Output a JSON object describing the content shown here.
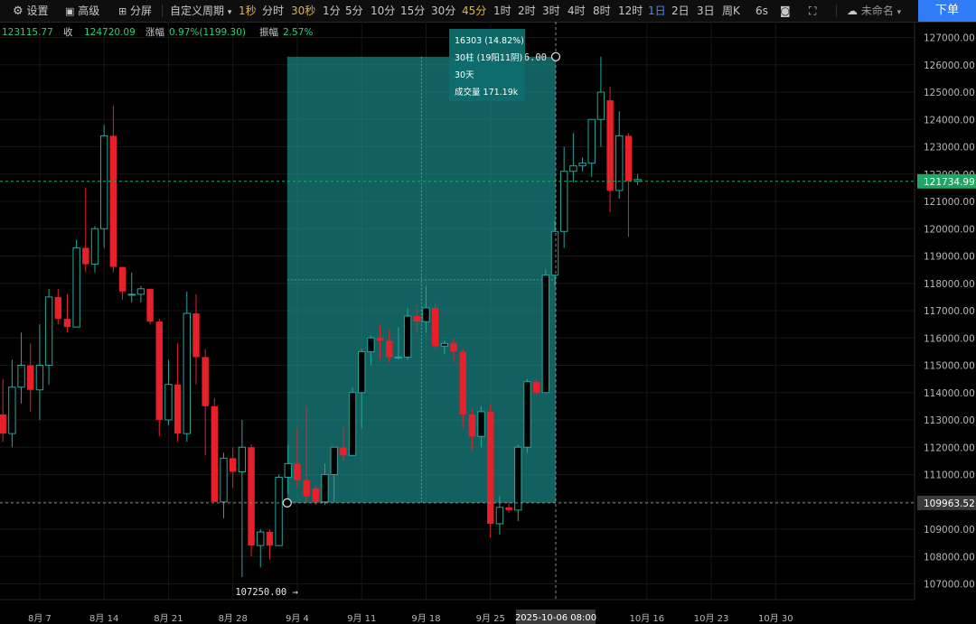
{
  "toolbar": {
    "settings": "设置",
    "advanced": "高级",
    "split": "分屏",
    "custom_period": "自定义周期",
    "periods": [
      "1秒",
      "分时",
      "30秒",
      "1分",
      "5分",
      "10分",
      "15分",
      "30分",
      "45分",
      "1时",
      "2时",
      "3时",
      "4时",
      "8时",
      "12时",
      "1日",
      "2日",
      "3日",
      "周K",
      "6s"
    ],
    "highlight_periods": [
      "1秒",
      "30秒",
      "45分"
    ],
    "active_period": "1日",
    "unnamed": "未命名",
    "order_button": "下单"
  },
  "info_bar": {
    "open_value": "123115.77",
    "close_label": "收",
    "close_value": "124720.09",
    "change_label": "涨幅",
    "change_value": "0.97%(1199.30)",
    "amplitude_label": "振幅",
    "amplitude_value": "2.57%"
  },
  "measure": {
    "line1": "16303 (14.82%)",
    "line2": "30柱 (19阳11阴)",
    "line3": "30天",
    "line4": "成交量 171.19k",
    "start_price": 109963.52,
    "end_price": 126296.0,
    "start_index": 31,
    "end_index": 60
  },
  "annotations": {
    "high_label": "126296.00",
    "low_label": "107250.00 →",
    "low_index": 26,
    "low_price": 107250.0,
    "current_price_label": "121734.99",
    "current_price": 121734.99,
    "crosshair_price_label": "109963.52",
    "crosshair_date_label": "2025-10-06 08:00",
    "crosshair_index": 60
  },
  "colors": {
    "up": "#26a69a",
    "down": "#e8202a",
    "price_badge": "#1ea863",
    "accent": "#e0b440",
    "active": "#4a8cf7",
    "order_button": "#2f7cf6",
    "measure_fill": "#1f9b9b"
  },
  "chart_data": {
    "type": "candlestick",
    "ylim": [
      106400,
      127500
    ],
    "yticks": [
      107000,
      108000,
      109000,
      110000,
      111000,
      112000,
      113000,
      114000,
      115000,
      116000,
      117000,
      118000,
      119000,
      120000,
      121000,
      122000,
      123000,
      124000,
      125000,
      126000,
      127000
    ],
    "xticks": [
      {
        "label": "8月 7",
        "index": 4
      },
      {
        "label": "8月 14",
        "index": 11
      },
      {
        "label": "8月 21",
        "index": 18
      },
      {
        "label": "8月 28",
        "index": 25
      },
      {
        "label": "9月 4",
        "index": 32
      },
      {
        "label": "9月 11",
        "index": 39
      },
      {
        "label": "9月 18",
        "index": 46
      },
      {
        "label": "9月 25",
        "index": 53
      },
      {
        "label": "10月 16",
        "index": 70
      },
      {
        "label": "10月 23",
        "index": 77
      },
      {
        "label": "10月 30",
        "index": 84
      }
    ],
    "candles": [
      {
        "o": 113200,
        "h": 114500,
        "l": 112200,
        "c": 112500
      },
      {
        "o": 112500,
        "h": 115200,
        "l": 112000,
        "c": 114200
      },
      {
        "o": 114200,
        "h": 116200,
        "l": 113600,
        "c": 115000
      },
      {
        "o": 115000,
        "h": 115800,
        "l": 113300,
        "c": 114100
      },
      {
        "o": 114100,
        "h": 116500,
        "l": 113000,
        "c": 115000
      },
      {
        "o": 115000,
        "h": 117800,
        "l": 114300,
        "c": 117500
      },
      {
        "o": 117500,
        "h": 117800,
        "l": 116500,
        "c": 116700
      },
      {
        "o": 116700,
        "h": 117600,
        "l": 116200,
        "c": 116400
      },
      {
        "o": 116400,
        "h": 119600,
        "l": 116400,
        "c": 119300
      },
      {
        "o": 119300,
        "h": 121500,
        "l": 118400,
        "c": 118700
      },
      {
        "o": 118700,
        "h": 120100,
        "l": 118400,
        "c": 120000
      },
      {
        "o": 120000,
        "h": 123800,
        "l": 119300,
        "c": 123400
      },
      {
        "o": 123400,
        "h": 124500,
        "l": 118400,
        "c": 118600
      },
      {
        "o": 118600,
        "h": 118600,
        "l": 117400,
        "c": 117700
      },
      {
        "o": 117600,
        "h": 118400,
        "l": 117300,
        "c": 117600
      },
      {
        "o": 117600,
        "h": 117900,
        "l": 117300,
        "c": 117800
      },
      {
        "o": 117800,
        "h": 117800,
        "l": 116500,
        "c": 116600
      },
      {
        "o": 116600,
        "h": 116700,
        "l": 112400,
        "c": 113000
      },
      {
        "o": 113000,
        "h": 115200,
        "l": 112800,
        "c": 114300
      },
      {
        "o": 114300,
        "h": 115800,
        "l": 112200,
        "c": 112500
      },
      {
        "o": 112500,
        "h": 117700,
        "l": 112200,
        "c": 116900
      },
      {
        "o": 116900,
        "h": 117600,
        "l": 114300,
        "c": 115300
      },
      {
        "o": 115300,
        "h": 115600,
        "l": 111700,
        "c": 113500
      },
      {
        "o": 113500,
        "h": 113800,
        "l": 110600,
        "c": 110000
      },
      {
        "o": 110000,
        "h": 111800,
        "l": 109400,
        "c": 111600
      },
      {
        "o": 111600,
        "h": 112000,
        "l": 110500,
        "c": 111100
      },
      {
        "o": 111100,
        "h": 113000,
        "l": 107250,
        "c": 112000
      },
      {
        "o": 112000,
        "h": 112100,
        "l": 108000,
        "c": 108400
      },
      {
        "o": 108400,
        "h": 109000,
        "l": 107600,
        "c": 108900
      },
      {
        "o": 108900,
        "h": 109000,
        "l": 107900,
        "c": 108400
      },
      {
        "o": 108400,
        "h": 111000,
        "l": 108400,
        "c": 110900
      },
      {
        "o": 110900,
        "h": 112100,
        "l": 110300,
        "c": 111400
      },
      {
        "o": 111400,
        "h": 112700,
        "l": 110500,
        "c": 110800
      },
      {
        "o": 110800,
        "h": 113500,
        "l": 110000,
        "c": 110200
      },
      {
        "o": 110500,
        "h": 110600,
        "l": 109900,
        "c": 110000
      },
      {
        "o": 110000,
        "h": 111400,
        "l": 109900,
        "c": 111000
      },
      {
        "o": 111000,
        "h": 112000,
        "l": 110000,
        "c": 112000
      },
      {
        "o": 112000,
        "h": 112800,
        "l": 111500,
        "c": 111700
      },
      {
        "o": 111700,
        "h": 114200,
        "l": 111700,
        "c": 114000
      },
      {
        "o": 114000,
        "h": 115600,
        "l": 112700,
        "c": 115500
      },
      {
        "o": 115500,
        "h": 116100,
        "l": 115000,
        "c": 116000
      },
      {
        "o": 116000,
        "h": 116500,
        "l": 115200,
        "c": 115900
      },
      {
        "o": 115900,
        "h": 116300,
        "l": 115100,
        "c": 115300
      },
      {
        "o": 115300,
        "h": 116400,
        "l": 115200,
        "c": 115300
      },
      {
        "o": 115300,
        "h": 117100,
        "l": 115200,
        "c": 116800
      },
      {
        "o": 116800,
        "h": 117200,
        "l": 116200,
        "c": 116600
      },
      {
        "o": 116600,
        "h": 117900,
        "l": 116200,
        "c": 117100
      },
      {
        "o": 117100,
        "h": 117300,
        "l": 115600,
        "c": 115700
      },
      {
        "o": 115700,
        "h": 115900,
        "l": 115400,
        "c": 115800
      },
      {
        "o": 115800,
        "h": 116000,
        "l": 115100,
        "c": 115500
      },
      {
        "o": 115500,
        "h": 115600,
        "l": 112700,
        "c": 113200
      },
      {
        "o": 113200,
        "h": 113400,
        "l": 111900,
        "c": 112400
      },
      {
        "o": 112400,
        "h": 113500,
        "l": 112000,
        "c": 113300
      },
      {
        "o": 113300,
        "h": 113600,
        "l": 108700,
        "c": 109200
      },
      {
        "o": 109200,
        "h": 110200,
        "l": 108800,
        "c": 109800
      },
      {
        "o": 109800,
        "h": 110000,
        "l": 109600,
        "c": 109700
      },
      {
        "o": 109700,
        "h": 112100,
        "l": 109300,
        "c": 112000
      },
      {
        "o": 112000,
        "h": 114500,
        "l": 111800,
        "c": 114400
      },
      {
        "o": 114400,
        "h": 114500,
        "l": 113900,
        "c": 114000
      },
      {
        "o": 114000,
        "h": 118500,
        "l": 114000,
        "c": 118300
      },
      {
        "o": 118300,
        "h": 120300,
        "l": 117900,
        "c": 119900
      },
      {
        "o": 119900,
        "h": 123000,
        "l": 119300,
        "c": 122100
      },
      {
        "o": 122100,
        "h": 123500,
        "l": 121700,
        "c": 122300
      },
      {
        "o": 122300,
        "h": 122600,
        "l": 122100,
        "c": 122400
      },
      {
        "o": 122400,
        "h": 124000,
        "l": 121900,
        "c": 124000
      },
      {
        "o": 124000,
        "h": 126296,
        "l": 123000,
        "c": 125000
      },
      {
        "o": 124700,
        "h": 125200,
        "l": 120600,
        "c": 121400
      },
      {
        "o": 121400,
        "h": 124300,
        "l": 121100,
        "c": 123400
      },
      {
        "o": 123400,
        "h": 123500,
        "l": 119700,
        "c": 121734.99
      },
      {
        "o": 121734.99,
        "h": 122000,
        "l": 121600,
        "c": 121800
      }
    ]
  }
}
